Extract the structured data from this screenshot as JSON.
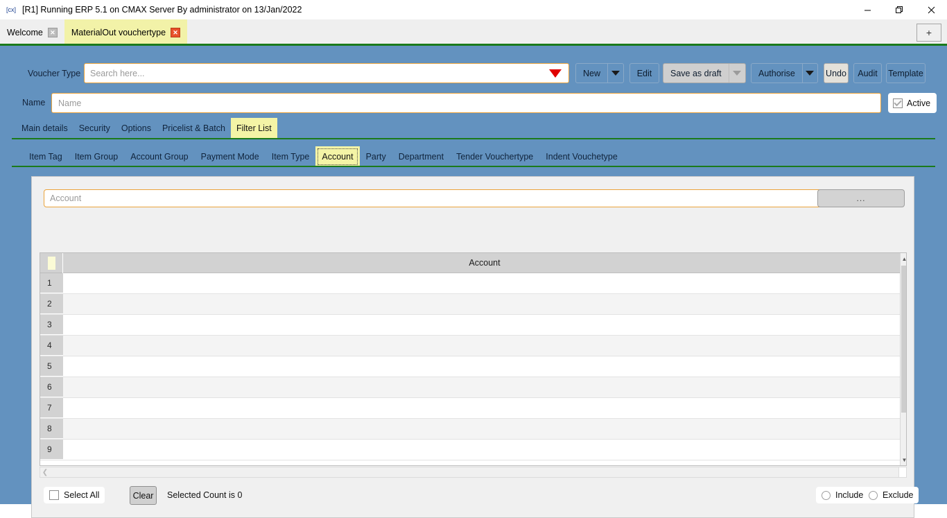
{
  "window": {
    "icon": "app-icon",
    "title": "[R1] Running ERP 5.1 on CMAX Server By administrator on 13/Jan/2022",
    "minimize": "–",
    "restore": "❐",
    "close": "✕"
  },
  "tabs": {
    "items": [
      {
        "label": "Welcome",
        "close": "✕",
        "active": false
      },
      {
        "label": "MaterialOut vouchertype",
        "close": "✕",
        "active": true
      }
    ],
    "new_tab": "+"
  },
  "form": {
    "voucher_type_label": "Voucher Type",
    "voucher_type_value": "",
    "voucher_type_placeholder": "Search here...",
    "name_label": "Name",
    "name_value": "",
    "name_placeholder": "Name",
    "active_label": "Active",
    "active_checked": true
  },
  "toolbar": {
    "new_label": "New",
    "edit_label": "Edit",
    "save_as_draft_label": "Save as draft",
    "authorise_label": "Authorise",
    "undo_label": "Undo",
    "audit_label": "Audit",
    "template_label": "Template"
  },
  "primary_tabs": [
    {
      "label": "Main details",
      "active": false
    },
    {
      "label": "Security",
      "active": false
    },
    {
      "label": "Options",
      "active": false
    },
    {
      "label": "Pricelist & Batch",
      "active": false
    },
    {
      "label": "Filter List",
      "active": true
    }
  ],
  "secondary_tabs": [
    {
      "label": "Item Tag",
      "active": false
    },
    {
      "label": "Item Group",
      "active": false
    },
    {
      "label": "Account Group",
      "active": false
    },
    {
      "label": "Payment Mode",
      "active": false
    },
    {
      "label": "Item Type",
      "active": false
    },
    {
      "label": "Account",
      "active": true
    },
    {
      "label": "Party",
      "active": false
    },
    {
      "label": "Department",
      "active": false
    },
    {
      "label": "Tender Vouchertype",
      "active": false
    },
    {
      "label": "Indent Vouchetype",
      "active": false
    }
  ],
  "panel": {
    "account_value": "",
    "account_placeholder": "Account",
    "browse_label": "...",
    "grid": {
      "column_header": "Account",
      "rows": [
        {
          "num": "1",
          "account": ""
        },
        {
          "num": "2",
          "account": ""
        },
        {
          "num": "3",
          "account": ""
        },
        {
          "num": "4",
          "account": ""
        },
        {
          "num": "5",
          "account": ""
        },
        {
          "num": "6",
          "account": ""
        },
        {
          "num": "7",
          "account": ""
        },
        {
          "num": "8",
          "account": ""
        },
        {
          "num": "9",
          "account": ""
        }
      ]
    },
    "footer": {
      "select_all_label": "Select All",
      "select_all_checked": false,
      "clear_label": "Clear",
      "count_text": "Selected Count is 0",
      "include_label": "Include",
      "include_selected": false,
      "exclude_label": "Exclude",
      "exclude_selected": false
    }
  },
  "colors": {
    "body_blue": "#6392bf",
    "tab_active_yellow": "#f2f2a8",
    "rule_green": "#1b7a1b",
    "field_border_orange": "#eaa33c",
    "close_red": "#e8512a"
  }
}
